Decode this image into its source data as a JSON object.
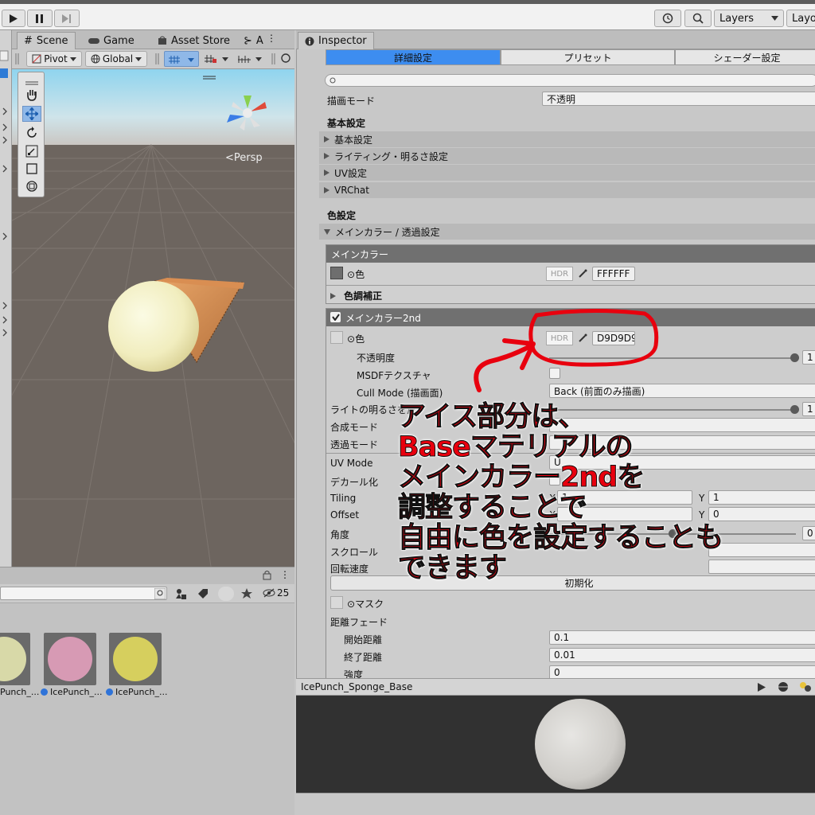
{
  "toolbar": {
    "layers_label": "Layers",
    "layout_label": "Layo"
  },
  "scene_tabs": [
    {
      "label": "Scene"
    },
    {
      "label": "Game"
    },
    {
      "label": "Asset Store"
    },
    {
      "label": "A"
    }
  ],
  "scene_toolbar": {
    "pivot": "Pivot",
    "global": "Global"
  },
  "scene_view": {
    "persp_label": "Persp"
  },
  "project": {
    "visible_count": "25",
    "assets": [
      {
        "name": "Punch_...",
        "color": "#d8d9a8"
      },
      {
        "name": "IcePunch_...",
        "color": "#d79ab4"
      },
      {
        "name": "IcePunch_...",
        "color": "#d6cf5e"
      }
    ]
  },
  "inspector": {
    "tab_label": "Inspector",
    "seg_tabs": [
      "詳細設定",
      "プリセット",
      "シェーダー設定"
    ],
    "render_mode": {
      "label": "描画モード",
      "value": "不透明"
    },
    "basic_header": "基本設定",
    "sections": [
      "基本設定",
      "ライティング・明るさ設定",
      "UV設定",
      "VRChat"
    ],
    "color_header": "色設定",
    "main_color_section": "メインカラー / 透過設定",
    "main_color": {
      "title": "メインカラー",
      "color_label": "色",
      "hdr": "HDR",
      "hex": "FFFFFF",
      "color_swatch": "#6e6e6e",
      "tone_label": "色調補正"
    },
    "main_color_2nd": {
      "title": "メインカラー2nd",
      "color_label": "色",
      "hdr": "HDR",
      "hex": "D9D9D9",
      "opacity_label": "不透明度",
      "opacity_value": "1",
      "msdf_label": "MSDFテクスチャ",
      "cull_label": "Cull Mode (描画面)",
      "cull_value": "Back (前面のみ描画)",
      "light_label": "ライトの明るさを反",
      "light_value": "1",
      "blend_label": "合成モード",
      "alpha_label": "透過モード",
      "uvmode_label": "UV Mode",
      "uvmode_value": "U",
      "decal_label": "デカール化",
      "tiling_label": "Tiling",
      "tiling_x": "1",
      "tiling_y": "1",
      "offset_label": "Offset",
      "offset_y": "0",
      "angle_label": "角度",
      "angle_value": "0",
      "scroll_label": "スクロール",
      "rotspeed_label": "回転速度",
      "reset_label": "初期化",
      "mask_label": "マスク",
      "distfade_label": "距離フェード",
      "fade_start_label": "開始距離",
      "fade_start_value": "0.1",
      "fade_end_label": "終了距離",
      "fade_end_value": "0.01",
      "strength_label": "強度",
      "strength_value": "0"
    },
    "y_axis": "Y",
    "x_axis": "X"
  },
  "preview": {
    "title": "IcePunch_Sponge_Base"
  },
  "annotation": {
    "lines": [
      "アイス部分は、",
      "Baseマテリアルの",
      "メインカラー2ndを",
      "調整することで",
      "自由に色を設定することも",
      "できます"
    ],
    "color": "#e8000e"
  }
}
